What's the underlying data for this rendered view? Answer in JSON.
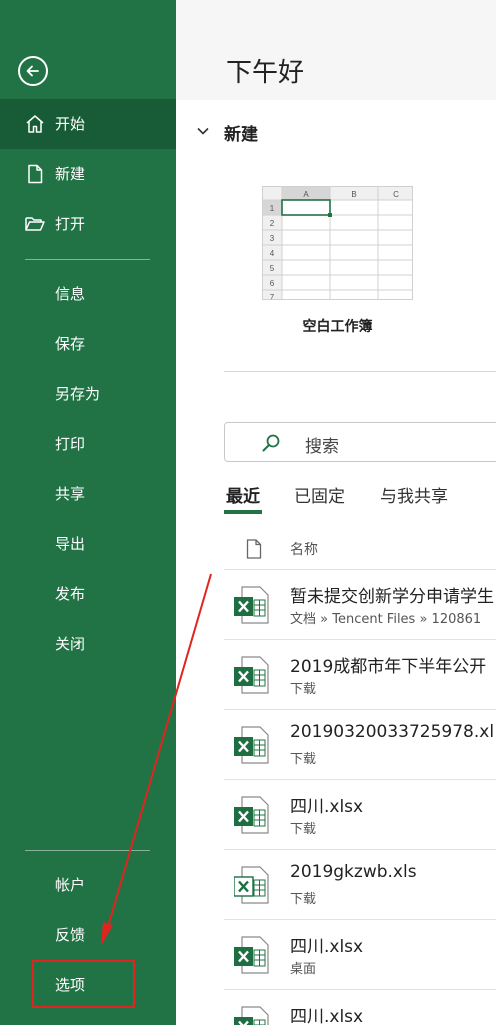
{
  "sidebar": {
    "items": [
      {
        "label": "开始"
      },
      {
        "label": "新建"
      },
      {
        "label": "打开"
      },
      {
        "label": "信息"
      },
      {
        "label": "保存"
      },
      {
        "label": "另存为"
      },
      {
        "label": "打印"
      },
      {
        "label": "共享"
      },
      {
        "label": "导出"
      },
      {
        "label": "发布"
      },
      {
        "label": "关闭"
      }
    ],
    "bottom_items": [
      {
        "label": "帐户"
      },
      {
        "label": "反馈"
      },
      {
        "label": "选项"
      }
    ]
  },
  "main": {
    "greeting": "下午好",
    "new_section_title": "新建",
    "template": {
      "label": "空白工作簿",
      "columns": [
        "A",
        "B",
        "C"
      ],
      "rows": [
        "1",
        "2",
        "3",
        "4",
        "5",
        "6",
        "7"
      ]
    },
    "search": {
      "placeholder": "搜索"
    },
    "tabs": [
      {
        "label": "最近"
      },
      {
        "label": "已固定"
      },
      {
        "label": "与我共享"
      }
    ],
    "file_list_header": {
      "name": "名称"
    },
    "files": [
      {
        "name": "暂未提交创新学分申请学生",
        "path": "文档 » Tencent Files » 120861"
      },
      {
        "name": "2019成都市年下半年公开",
        "path": "下载"
      },
      {
        "name": "20190320033725978.xl",
        "path": "下载"
      },
      {
        "name": "四川.xlsx",
        "path": "下载"
      },
      {
        "name": "2019gkzwb.xls",
        "path": "下载"
      },
      {
        "name": "四川.xlsx",
        "path": "桌面"
      },
      {
        "name": "四川.xlsx",
        "path": ""
      }
    ]
  },
  "colors": {
    "sidebar_bg": "#217346",
    "sidebar_active": "#185c37",
    "annotation_red": "#e0241f"
  }
}
